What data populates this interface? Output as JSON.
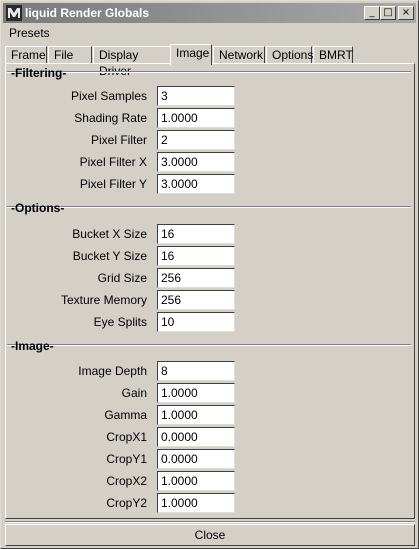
{
  "window": {
    "title": "liquid Render Globals"
  },
  "titlebar_buttons": {
    "minimize": "_",
    "maximize": "□",
    "close": "×"
  },
  "menu": {
    "presets": "Presets"
  },
  "tabs": [
    {
      "label": "Frame"
    },
    {
      "label": "File"
    },
    {
      "label": "Display Driver"
    },
    {
      "label": "Image"
    },
    {
      "label": "Network"
    },
    {
      "label": "Options"
    },
    {
      "label": "BMRT"
    }
  ],
  "active_tab": "Image",
  "sections": {
    "filtering": {
      "title": "-Filtering-",
      "fields": [
        {
          "label": "Pixel Samples",
          "value": "3"
        },
        {
          "label": "Shading Rate",
          "value": "1.0000"
        },
        {
          "label": "Pixel Filter",
          "value": "2"
        },
        {
          "label": "Pixel Filter X",
          "value": "3.0000"
        },
        {
          "label": "Pixel Filter Y",
          "value": "3.0000"
        }
      ]
    },
    "options": {
      "title": "-Options-",
      "fields": [
        {
          "label": "Bucket X Size",
          "value": "16"
        },
        {
          "label": "Bucket Y Size",
          "value": "16"
        },
        {
          "label": "Grid Size",
          "value": "256"
        },
        {
          "label": "Texture Memory",
          "value": "256"
        },
        {
          "label": "Eye Splits",
          "value": "10"
        }
      ]
    },
    "image": {
      "title": "-Image-",
      "fields": [
        {
          "label": "Image Depth",
          "value": "8"
        },
        {
          "label": "Gain",
          "value": "1.0000"
        },
        {
          "label": "Gamma",
          "value": "1.0000"
        },
        {
          "label": "CropX1",
          "value": "0.0000"
        },
        {
          "label": "CropY1",
          "value": "0.0000"
        },
        {
          "label": "CropX2",
          "value": "1.0000"
        },
        {
          "label": "CropY2",
          "value": "1.0000"
        }
      ]
    }
  },
  "footer": {
    "close_label": "Close"
  }
}
